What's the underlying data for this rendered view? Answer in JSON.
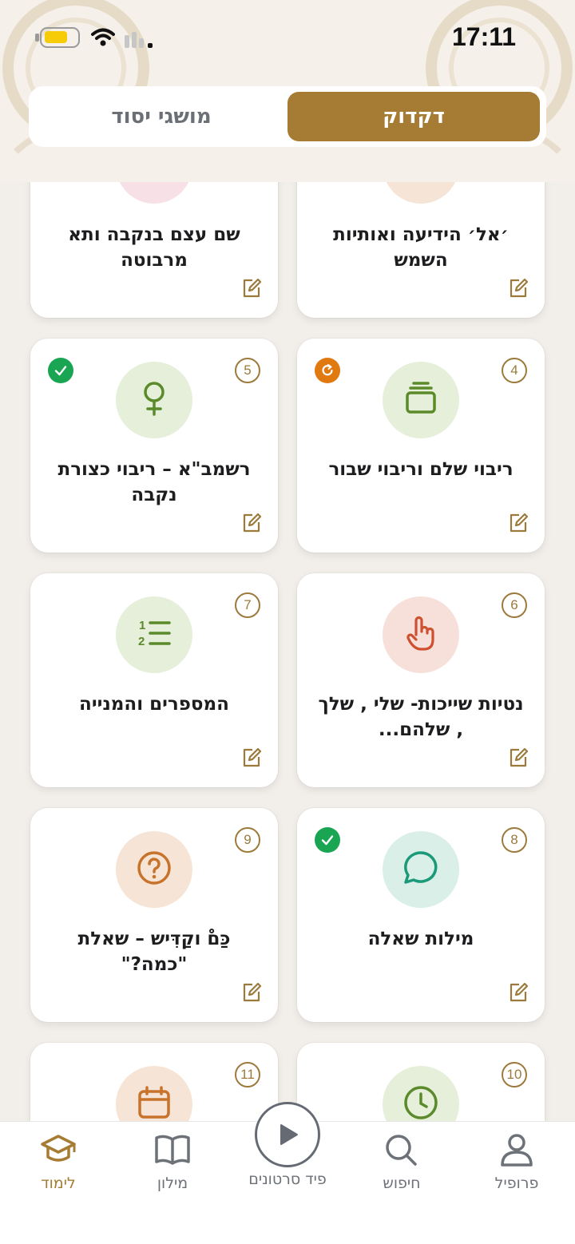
{
  "status_bar": {
    "time": "17:11"
  },
  "segments": {
    "active": "דקדוק",
    "inactive": "מושגי יסוד"
  },
  "cards": [
    {
      "title": "שם עצם בנקבה ותא מרבוטה",
      "icon": "female-symbol-icon",
      "color": "#c4476e",
      "bg": "#f7e1e7"
    },
    {
      "title": "׳אל׳ הידיעה ואותיות השמש",
      "icon": "sun-icon",
      "color": "#c8732c",
      "bg": "#f6e5d6"
    },
    {
      "number": "5",
      "title": "רשמב\"א – ריבוי כצורת נקבה",
      "icon": "female-symbol-icon",
      "color": "#5b8a2a",
      "bg": "#e5efda",
      "status": "done"
    },
    {
      "number": "4",
      "title": "ריבוי שלם וריבוי שבור",
      "icon": "layers-icon",
      "color": "#5b8a2a",
      "bg": "#e5efda",
      "status": "in-progress"
    },
    {
      "number": "7",
      "title": "המספרים והמנייה",
      "icon": "numbered-list-icon",
      "color": "#5b8a2a",
      "bg": "#e5efda"
    },
    {
      "number": "6",
      "title": "נטיות שייכות- שלי , שלך , שלהם...",
      "icon": "pointing-hand-icon",
      "color": "#cf4f31",
      "bg": "#f8e0da"
    },
    {
      "number": "9",
      "title": "כַּםْ וקַדִּיש – שאלת \"כמה?\"",
      "icon": "question-icon",
      "color": "#c8732c",
      "bg": "#f6e5d6"
    },
    {
      "number": "8",
      "title": "מילות שאלה",
      "icon": "chat-bubble-icon",
      "color": "#1a9a78",
      "bg": "#d9efe8",
      "status": "done"
    },
    {
      "number": "11",
      "title": "",
      "icon": "calendar-icon",
      "color": "#c8732c",
      "bg": "#f6e5d6"
    },
    {
      "number": "10",
      "title": "",
      "icon": "clock-icon",
      "color": "#5b8a2a",
      "bg": "#e5efda"
    }
  ],
  "tabs": {
    "learn": "לימוד",
    "dictionary": "מילון",
    "videos": "פיד סרטונים",
    "search": "חיפוש",
    "profile": "פרופיל"
  },
  "colors": {
    "accent": "#a67c35",
    "done": "#1aa553",
    "progress": "#e07a10"
  }
}
